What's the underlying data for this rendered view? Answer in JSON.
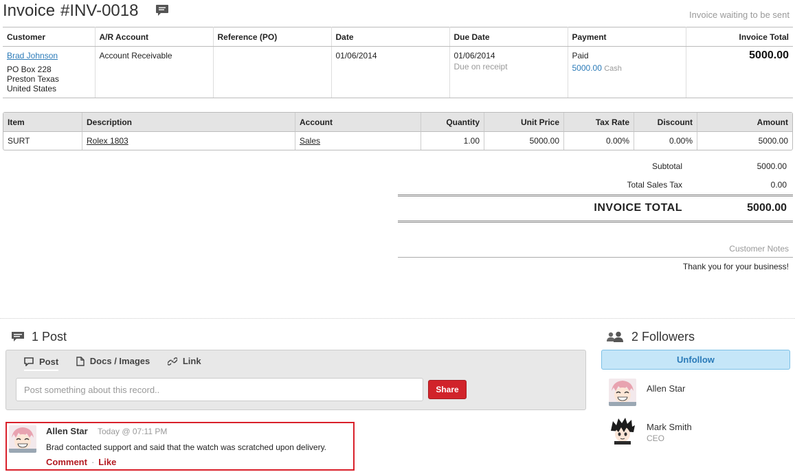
{
  "header": {
    "title": "Invoice",
    "invoice_number": "#INV-0018",
    "status_text": "Invoice waiting to be sent"
  },
  "info": {
    "columns": [
      "Customer",
      "A/R Account",
      "Reference (PO)",
      "Date",
      "Due Date",
      "Payment",
      "Invoice Total"
    ],
    "customer_name": "Brad Johnson",
    "customer_address": [
      "PO Box 228",
      "Preston Texas",
      "United States"
    ],
    "ar_account": "Account Receivable",
    "reference": "",
    "date": "01/06/2014",
    "due_date": "01/06/2014",
    "due_note": "Due on receipt",
    "payment_status": "Paid",
    "payment_amount": "5000.00",
    "payment_method": "Cash",
    "invoice_total": "5000.00"
  },
  "items": {
    "columns": [
      "Item",
      "Description",
      "Account",
      "Quantity",
      "Unit Price",
      "Tax Rate",
      "Discount",
      "Amount"
    ],
    "rows": [
      {
        "item": "SURT",
        "description": "Rolex 1803",
        "account": "Sales",
        "quantity": "1.00",
        "unit_price": "5000.00",
        "tax_rate": "0.00%",
        "discount": "0.00%",
        "amount": "5000.00"
      }
    ]
  },
  "summary": {
    "subtotal_label": "Subtotal",
    "subtotal_value": "5000.00",
    "tax_label": "Total Sales Tax",
    "tax_value": "0.00",
    "total_label": "INVOICE TOTAL",
    "total_value": "5000.00",
    "notes_label": "Customer Notes",
    "notes_text": "Thank you for your business!"
  },
  "posts": {
    "heading": "1 Post",
    "tabs": [
      "Post",
      "Docs / Images",
      "Link"
    ],
    "input_placeholder": "Post something about this record..",
    "share_label": "Share",
    "items": [
      {
        "author": "Allen Star",
        "time": "Today @ 07:11 PM",
        "body": "Brad contacted support and said that the watch was scratched upon delivery.",
        "comment_label": "Comment",
        "separator": "·",
        "like_label": "Like"
      }
    ]
  },
  "followers": {
    "heading": "2 Followers",
    "unfollow_label": "Unfollow",
    "list": [
      {
        "name": "Allen Star",
        "subtitle": ""
      },
      {
        "name": "Mark Smith",
        "subtitle": "CEO"
      }
    ]
  },
  "colors": {
    "link": "#2a7ab8",
    "share_button": "#d1232a",
    "highlight_border": "#d9202a",
    "unfollow_bg": "#c5e6f8"
  },
  "icons": [
    "comment-icon",
    "posts-icon",
    "document-icon",
    "link-icon",
    "followers-icon"
  ]
}
